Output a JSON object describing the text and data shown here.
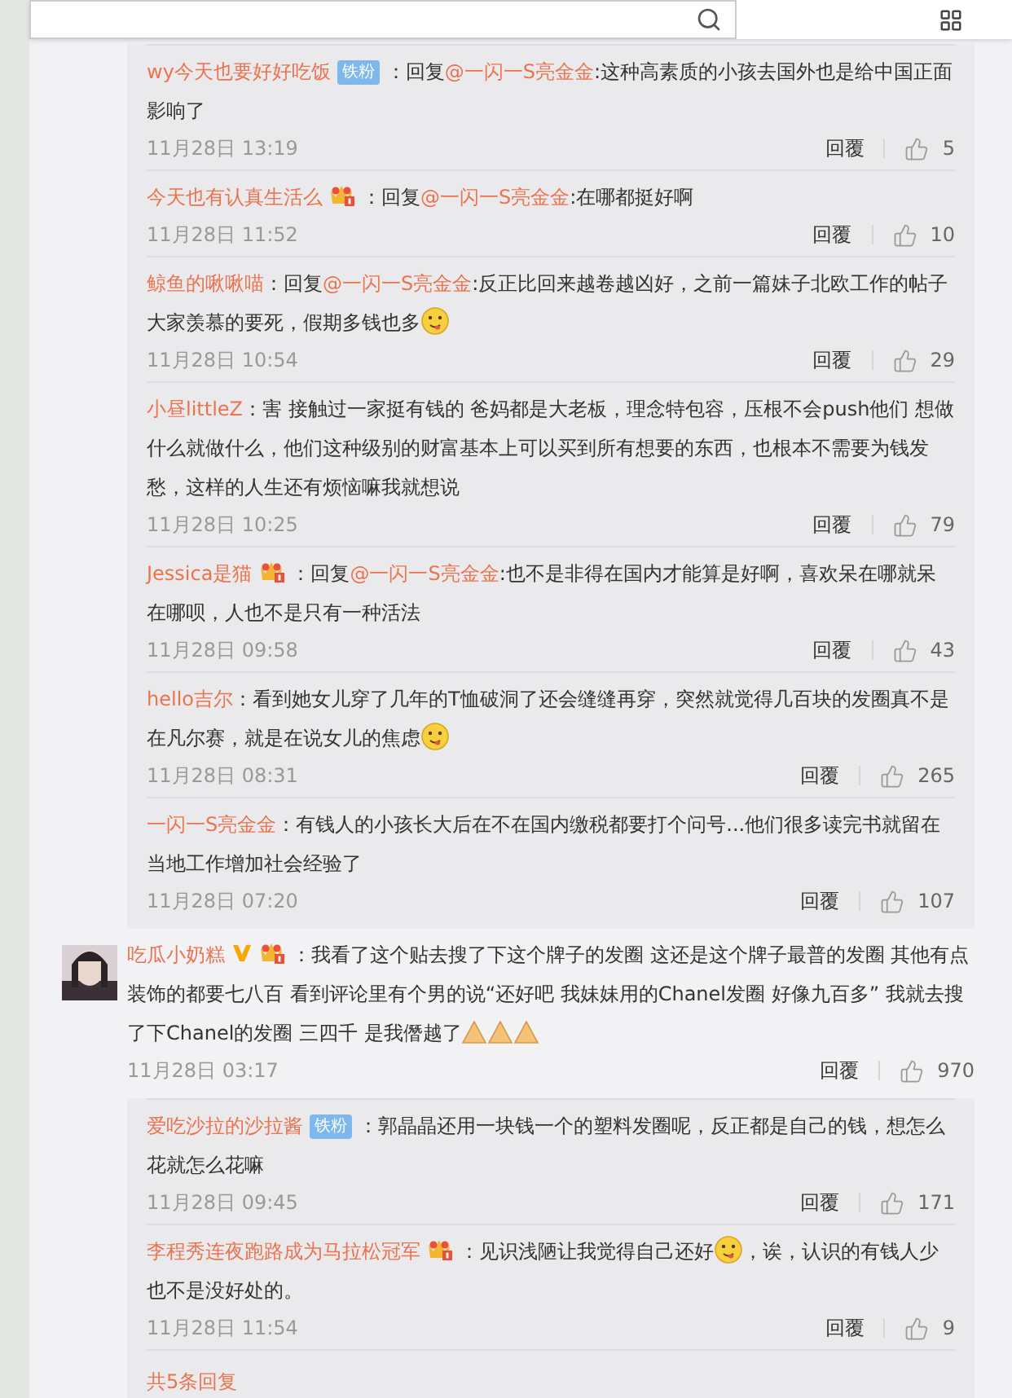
{
  "thread_replies": [
    {
      "user": "wy今天也要好好吃饭",
      "badge": {
        "kind": "fan",
        "label": "铁粉"
      },
      "sep": "：",
      "segments": [
        {
          "kind": "text",
          "text": "回复"
        },
        {
          "kind": "mention",
          "text": "@一闪一S亮金金"
        },
        {
          "kind": "text",
          "text": ":这种高素质的小孩去国外也是给中国正面影响了"
        }
      ],
      "time": "11月28日 13:19",
      "reply": "回覆",
      "likes": "5"
    },
    {
      "user": "今天也有认真生活么",
      "badge": {
        "kind": "crown"
      },
      "sep": "：",
      "segments": [
        {
          "kind": "text",
          "text": "回复"
        },
        {
          "kind": "mention",
          "text": "@一闪一S亮金金"
        },
        {
          "kind": "text",
          "text": ":在哪都挺好啊"
        }
      ],
      "time": "11月28日 11:52",
      "reply": "回覆",
      "likes": "10"
    },
    {
      "user": "鲸鱼的啾啾喵",
      "sep": "：",
      "segments": [
        {
          "kind": "text",
          "text": "回复"
        },
        {
          "kind": "mention",
          "text": "@一闪一S亮金金"
        },
        {
          "kind": "text",
          "text": ":反正比回来越卷越凶好，之前一篇妹子北欧工作的帖子大家羡慕的要死，假期多钱也多"
        },
        {
          "kind": "face"
        }
      ],
      "time": "11月28日 10:54",
      "reply": "回覆",
      "likes": "29"
    },
    {
      "user": "小昼littleZ",
      "sep": "：",
      "segments": [
        {
          "kind": "text",
          "text": "害 接触过一家挺有钱的 爸妈都是大老板，理念特包容，压根不会push他们 想做什么就做什么，他们这种级别的财富基本上可以买到所有想要的东西，也根本不需要为钱发愁，这样的人生还有烦恼嘛我就想说"
        }
      ],
      "time": "11月28日 10:25",
      "reply": "回覆",
      "likes": "79"
    },
    {
      "user": "Jessica是猫",
      "badge": {
        "kind": "crown"
      },
      "sep": "：",
      "segments": [
        {
          "kind": "text",
          "text": "回复"
        },
        {
          "kind": "mention",
          "text": "@一闪一S亮金金"
        },
        {
          "kind": "text",
          "text": ":也不是非得在国内才能算是好啊，喜欢呆在哪就呆在哪呗，人也不是只有一种活法"
        }
      ],
      "time": "11月28日 09:58",
      "reply": "回覆",
      "likes": "43"
    },
    {
      "user": "hello吉尔",
      "sep": "：",
      "segments": [
        {
          "kind": "text",
          "text": "看到她女儿穿了几年的T恤破洞了还会缝缝再穿，突然就觉得几百块的发圈真不是在凡尔赛，就是在说女儿的焦虑"
        },
        {
          "kind": "face"
        }
      ],
      "time": "11月28日 08:31",
      "reply": "回覆",
      "likes": "265"
    },
    {
      "user": "一闪一S亮金金",
      "sep": "：",
      "segments": [
        {
          "kind": "text",
          "text": "有钱人的小孩长大后在不在国内缴税都要打个问号...他们很多读完书就留在当地工作增加社会经验了"
        }
      ],
      "time": "11月28日 07:20",
      "reply": "回覆",
      "likes": "107"
    }
  ],
  "comment": {
    "user": "吃瓜小奶糕",
    "verified": true,
    "badge": {
      "kind": "crown"
    },
    "sep": "：",
    "segments": [
      {
        "kind": "text",
        "text": "我看了这个贴去搜了下这个牌子的发圈 这还是这个牌子最普的发圈 其他有点装饰的都要七八百 看到评论里有个男的说“还好吧 我妹妹用的Chanel发圈 好像九百多” 我就去搜了下Chanel的发圈 三四千 是我僭越了"
      },
      {
        "kind": "hands"
      }
    ],
    "time": "11月28日 03:17",
    "reply": "回覆",
    "likes": "970",
    "replies": [
      {
        "user": "爱吃沙拉的沙拉酱",
        "badge": {
          "kind": "fan",
          "label": "铁粉"
        },
        "sep": "：",
        "segments": [
          {
            "kind": "text",
            "text": "郭晶晶还用一块钱一个的塑料发圈呢，反正都是自己的钱，想怎么花就怎么花嘛"
          }
        ],
        "time": "11月28日 09:45",
        "reply": "回覆",
        "likes": "171"
      },
      {
        "user": "李程秀连夜跑路成为马拉松冠军",
        "badge": {
          "kind": "crown"
        },
        "sep": "：",
        "segments": [
          {
            "kind": "text",
            "text": "见识浅陋让我觉得自己还好"
          },
          {
            "kind": "face"
          },
          {
            "kind": "text",
            "text": "，诶，认识的有钱人少也不是没好处的。"
          }
        ],
        "time": "11月28日 11:54",
        "reply": "回覆",
        "likes": "9"
      }
    ],
    "more": "共5条回复"
  }
}
